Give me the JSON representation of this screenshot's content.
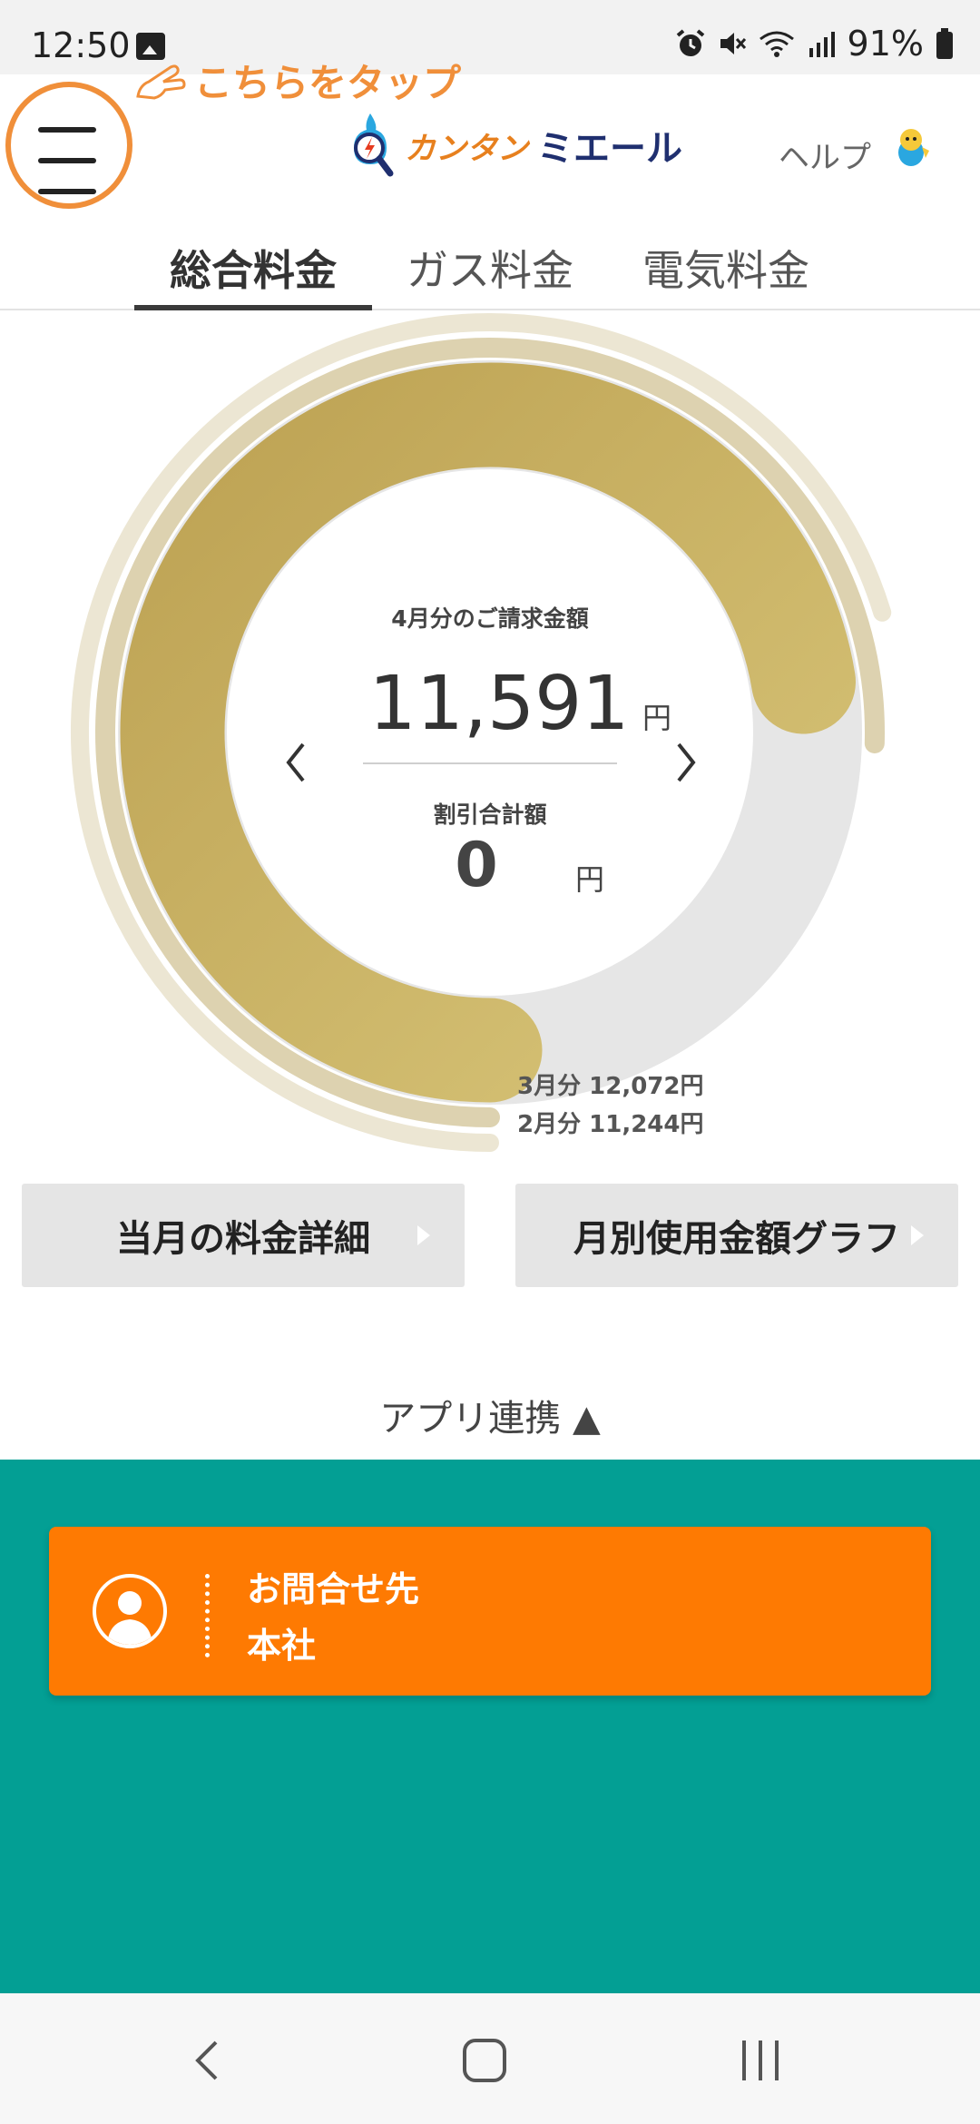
{
  "status_bar": {
    "time": "12:50",
    "battery": "91%",
    "icons": [
      "image-icon",
      "alarm-icon",
      "mute-icon",
      "wifi-icon",
      "signal-icon",
      "battery-icon"
    ]
  },
  "header": {
    "tap_hint": "こちらをタップ",
    "logo_part1": "カンタン",
    "logo_part2": "ミエール",
    "help": "ヘルプ"
  },
  "tabs": [
    {
      "label": "総合料金",
      "active": true
    },
    {
      "label": "ガス料金",
      "active": false
    },
    {
      "label": "電気料金",
      "active": false
    }
  ],
  "summary": {
    "period_label": "4月分のご請求金額",
    "total": "11,591",
    "currency": "円",
    "discount_label": "割引合計額",
    "discount": "0",
    "previous": [
      {
        "label": "3月分 12,072円",
        "amount": 12072
      },
      {
        "label": "2月分 11,244円",
        "amount": 11244
      }
    ],
    "current_amount": 11591,
    "colors": {
      "current_ring": "#c4a85a",
      "prev_ring": "#ddd2b0",
      "prev2_ring": "#ece6d3",
      "remaining": "#e6e6e6"
    }
  },
  "buttons": {
    "monthly_detail": "当月の料金詳細",
    "monthly_graph": "月別使用金額グラフ"
  },
  "app_link": "アプリ連携 ▲",
  "contact": {
    "title": "お問合せ先",
    "name": "本社"
  },
  "colors": {
    "teal": "#039f94",
    "orange": "#fe7a02",
    "accent": "#f08f3a"
  }
}
